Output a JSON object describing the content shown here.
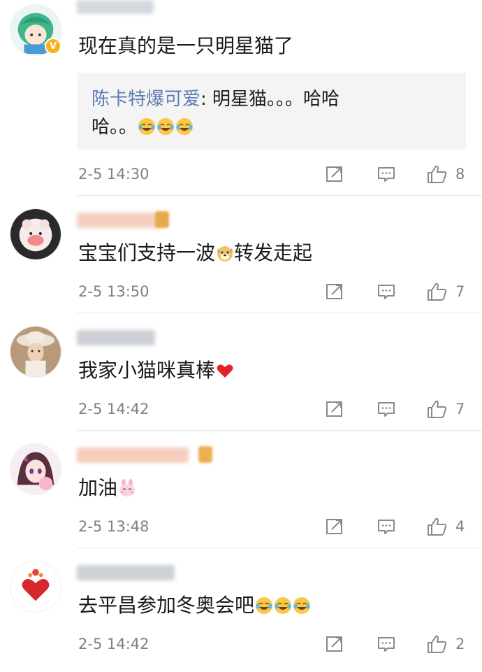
{
  "comments": [
    {
      "text": "现在真的是一只明星猫了",
      "quote": {
        "name": "陈卡特爆可爱",
        "separator": ": ",
        "text_line1": "明星猫。。。哈哈",
        "text_line2": "哈。。"
      },
      "time": "2-5 14:30",
      "likes": "8",
      "verified": "V"
    },
    {
      "text": "宝宝们支持一波",
      "text_after_emoji": "转发走起",
      "time": "2-5 13:50",
      "likes": "7"
    },
    {
      "text": "我家小猫咪真棒",
      "time": "2-5 14:42",
      "likes": "7"
    },
    {
      "text": "加油",
      "time": "2-5 13:48",
      "likes": "4"
    },
    {
      "text": "去平昌参加冬奥会吧",
      "time": "2-5 14:42",
      "likes": "2"
    }
  ],
  "colors": {
    "link": "#5b7db1",
    "meta": "#808080",
    "quote_bg": "#f4f4f4",
    "icon": "#8a8a8a"
  },
  "icons": {
    "share": "share-icon",
    "comment": "comment-icon",
    "like": "thumbs-up-icon"
  }
}
